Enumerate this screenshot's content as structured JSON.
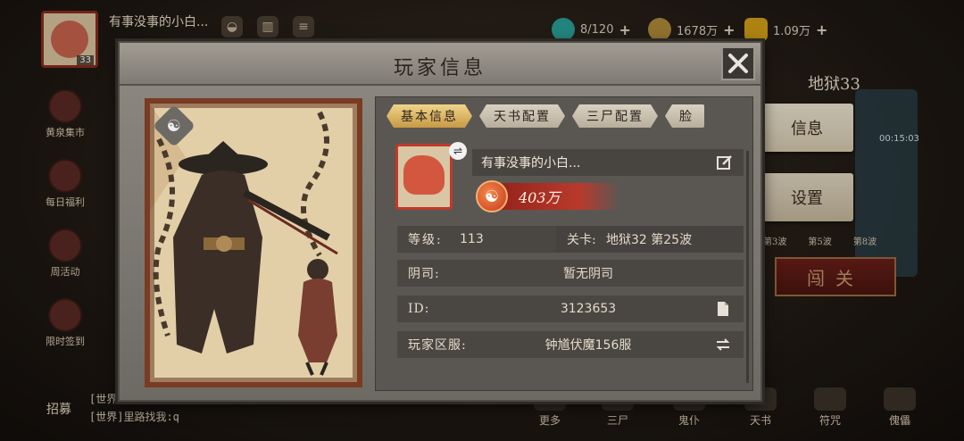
{
  "background": {
    "topbar": {
      "player_name": "有事没事的小白...",
      "avatar_level": "33",
      "resources": [
        {
          "icon": "jade-orb-icon",
          "value": "8/120",
          "color": "#2aa198"
        },
        {
          "icon": "coin-icon",
          "value": "1678万",
          "color": "#b08a3a"
        },
        {
          "icon": "gold-ingot-icon",
          "value": "1.09万",
          "color": "#d4a017"
        }
      ]
    },
    "left_menu": [
      {
        "label": "黄泉集市",
        "icon": "market-icon"
      },
      {
        "label": "每日福利",
        "icon": "gift-icon"
      },
      {
        "label": "周活动",
        "icon": "week-activity-icon"
      },
      {
        "label": "限时签到",
        "icon": "sign-in-icon"
      }
    ],
    "right": {
      "stage_title": "地狱33",
      "tab_info": "信息",
      "tab_settings": "设置",
      "timer": "00:15:03",
      "waves": [
        "第3波",
        "第5波",
        "第8波"
      ],
      "challenge_button": "闯关"
    },
    "bottom": {
      "chat_lines": [
        "[世界]",
        "[世界]里路找我:q"
      ],
      "recruit": "招募",
      "items": [
        "更多",
        "三尸",
        "鬼仆",
        "天书",
        "符咒",
        "傀儡"
      ]
    }
  },
  "modal": {
    "title": "玩家信息",
    "tabs": [
      "基本信息",
      "天书配置",
      "三尸配置",
      "脸"
    ],
    "active_tab": 0,
    "player_name": "有事没事的小白...",
    "power": "403万",
    "level_label": "等级:",
    "level_value": "113",
    "stage_label": "关卡:",
    "stage_value": "地狱32 第25波",
    "yinsi_label": "阴司:",
    "yinsi_value": "暂无阴司",
    "id_label": "ID:",
    "id_value": "3123653",
    "server_label": "玩家区服:",
    "server_value": "钟馗伏魔156服"
  },
  "colors": {
    "accent_tab": "#d9b262",
    "frame_red": "#7a3b23",
    "power_red": "#b93a2c"
  }
}
